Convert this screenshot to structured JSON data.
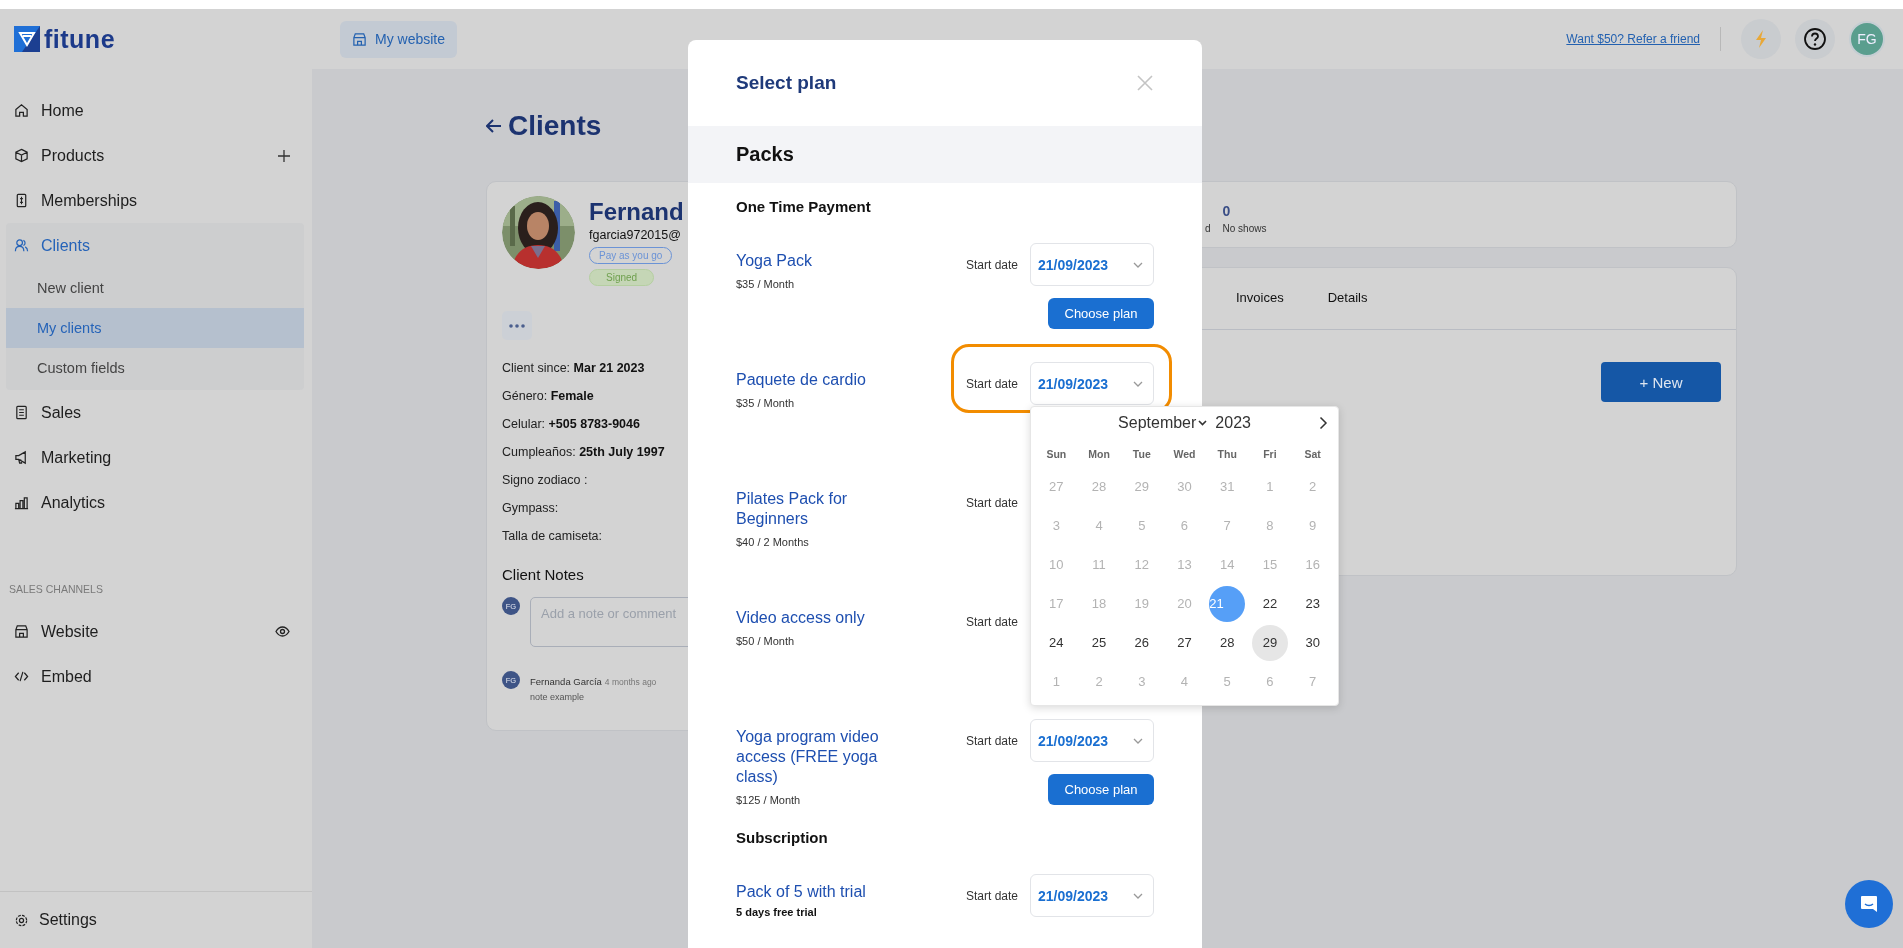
{
  "header": {
    "logo": "fitune",
    "website_button": "My website",
    "refer_link": "Want $50? Refer a friend",
    "avatar": "FG"
  },
  "sidebar": {
    "items": [
      {
        "label": "Home",
        "selected": false
      },
      {
        "label": "Products",
        "selected": false
      },
      {
        "label": "Memberships",
        "selected": false
      },
      {
        "label": "Clients",
        "selected": true,
        "expanded": true,
        "children": [
          {
            "label": "New client",
            "selected": false
          },
          {
            "label": "My clients",
            "selected": true
          },
          {
            "label": "Custom fields",
            "selected": false
          }
        ]
      },
      {
        "label": "Sales",
        "selected": false
      },
      {
        "label": "Marketing",
        "selected": false
      },
      {
        "label": "Analytics",
        "selected": false
      }
    ],
    "channels_heading": "SALES CHANNELS",
    "channels": [
      {
        "label": "Website",
        "selected": false
      },
      {
        "label": "Embed",
        "selected": false
      }
    ],
    "settings": "Settings"
  },
  "main": {
    "title": "Clients",
    "client": {
      "name": "Fernand",
      "email": "fgarcia972015@",
      "badges": [
        {
          "label": "Pay as you go",
          "kind": "plan"
        },
        {
          "label": "Signed",
          "kind": "status"
        }
      ],
      "details": [
        "Client since: **Mar 21 2023**",
        "Género: **Female**",
        "Celular: **+505 8783-9046**",
        "Cumpleaños: **25th July 1997**",
        "Signo zodiaco :",
        "Gympass:",
        "Talla de camiseta:"
      ],
      "notes_title": "Client Notes",
      "note_input": {
        "avatar": "FG",
        "placeholder": "Add a note or comment"
      },
      "notes": [
        {
          "avatar": "FG",
          "author": "Fernanda García",
          "time": "4 months ago",
          "text": "note example"
        }
      ]
    },
    "stats": [
      {
        "label": "d"
      },
      {
        "value": "0",
        "label": "No shows"
      }
    ],
    "tabs": [
      {
        "label": "Invoices",
        "selected": false
      },
      {
        "label": "Details",
        "selected": false
      }
    ],
    "new_button": "+ New"
  },
  "modal": {
    "title": "Select plan",
    "section": "Packs",
    "groups": [
      {
        "title": "One Time Payment",
        "plans": [
          {
            "name": "Yoga Pack",
            "price": "$35 / Month",
            "start_label": "Start date",
            "start_date": "21/09/2023",
            "button": "Choose plan",
            "highlighted": false
          },
          {
            "name": "Paquete de cardio",
            "price": "$35 / Month",
            "start_label": "Start date",
            "start_date": "21/09/2023",
            "highlighted": true,
            "calendar": {
              "month": "September",
              "year": "2023",
              "weekdays": [
                "Sun",
                "Mon",
                "Tue",
                "Wed",
                "Thu",
                "Fri",
                "Sat"
              ],
              "days": [
                {
                  "label": "27",
                  "disabled": true,
                  "selected": false,
                  "today": false
                },
                {
                  "label": "28",
                  "disabled": true,
                  "selected": false,
                  "today": false
                },
                {
                  "label": "29",
                  "disabled": true,
                  "selected": false,
                  "today": false
                },
                {
                  "label": "30",
                  "disabled": true,
                  "selected": false,
                  "today": false
                },
                {
                  "label": "31",
                  "disabled": true,
                  "selected": false,
                  "today": false
                },
                {
                  "label": "1",
                  "disabled": true,
                  "selected": false,
                  "today": false
                },
                {
                  "label": "2",
                  "disabled": true,
                  "selected": false,
                  "today": false
                },
                {
                  "label": "3",
                  "disabled": true,
                  "selected": false,
                  "today": false
                },
                {
                  "label": "4",
                  "disabled": true,
                  "selected": false,
                  "today": false
                },
                {
                  "label": "5",
                  "disabled": true,
                  "selected": false,
                  "today": false
                },
                {
                  "label": "6",
                  "disabled": true,
                  "selected": false,
                  "today": false
                },
                {
                  "label": "7",
                  "disabled": true,
                  "selected": false,
                  "today": false
                },
                {
                  "label": "8",
                  "disabled": true,
                  "selected": false,
                  "today": false
                },
                {
                  "label": "9",
                  "disabled": true,
                  "selected": false,
                  "today": false
                },
                {
                  "label": "10",
                  "disabled": true,
                  "selected": false,
                  "today": false
                },
                {
                  "label": "11",
                  "disabled": true,
                  "selected": false,
                  "today": false
                },
                {
                  "label": "12",
                  "disabled": true,
                  "selected": false,
                  "today": false
                },
                {
                  "label": "13",
                  "disabled": true,
                  "selected": false,
                  "today": false
                },
                {
                  "label": "14",
                  "disabled": true,
                  "selected": false,
                  "today": false
                },
                {
                  "label": "15",
                  "disabled": true,
                  "selected": false,
                  "today": false
                },
                {
                  "label": "16",
                  "disabled": true,
                  "selected": false,
                  "today": false
                },
                {
                  "label": "17",
                  "disabled": true,
                  "selected": false,
                  "today": false
                },
                {
                  "label": "18",
                  "disabled": true,
                  "selected": false,
                  "today": false
                },
                {
                  "label": "19",
                  "disabled": true,
                  "selected": false,
                  "today": false
                },
                {
                  "label": "20",
                  "disabled": true,
                  "selected": false,
                  "today": false
                },
                {
                  "label": "21",
                  "disabled": false,
                  "selected": true,
                  "today": false
                },
                {
                  "label": "22",
                  "disabled": false,
                  "selected": false,
                  "today": false
                },
                {
                  "label": "23",
                  "disabled": false,
                  "selected": false,
                  "today": false
                },
                {
                  "label": "24",
                  "disabled": false,
                  "selected": false,
                  "today": false
                },
                {
                  "label": "25",
                  "disabled": false,
                  "selected": false,
                  "today": false
                },
                {
                  "label": "26",
                  "disabled": false,
                  "selected": false,
                  "today": false
                },
                {
                  "label": "27",
                  "disabled": false,
                  "selected": false,
                  "today": false
                },
                {
                  "label": "28",
                  "disabled": false,
                  "selected": false,
                  "today": false
                },
                {
                  "label": "29",
                  "disabled": false,
                  "selected": false,
                  "today": true
                },
                {
                  "label": "30",
                  "disabled": false,
                  "selected": false,
                  "today": false
                },
                {
                  "label": "1",
                  "disabled": true,
                  "selected": false,
                  "today": false
                },
                {
                  "label": "2",
                  "disabled": true,
                  "selected": false,
                  "today": false
                },
                {
                  "label": "3",
                  "disabled": true,
                  "selected": false,
                  "today": false
                },
                {
                  "label": "4",
                  "disabled": true,
                  "selected": false,
                  "today": false
                },
                {
                  "label": "5",
                  "disabled": true,
                  "selected": false,
                  "today": false
                },
                {
                  "label": "6",
                  "disabled": true,
                  "selected": false,
                  "today": false
                },
                {
                  "label": "7",
                  "disabled": true,
                  "selected": false,
                  "today": false
                }
              ]
            }
          },
          {
            "name": "Pilates Pack for Beginners",
            "price": "$40 / 2 Months",
            "start_label": "Start date",
            "highlighted": false
          },
          {
            "name": "Video access only",
            "price": "$50 / Month",
            "start_label": "Start date",
            "highlighted": false
          },
          {
            "name": "Yoga program video access (FREE yoga class)",
            "price": "$125 / Month",
            "start_label": "Start date",
            "start_date": "21/09/2023",
            "button": "Choose plan",
            "highlighted": false
          }
        ]
      },
      {
        "title": "Subscription",
        "plans": [
          {
            "name": "Pack of 5 with trial",
            "note": "5 days free trial",
            "start_label": "Start date",
            "start_date": "21/09/2023",
            "highlighted": false
          }
        ]
      }
    ]
  }
}
